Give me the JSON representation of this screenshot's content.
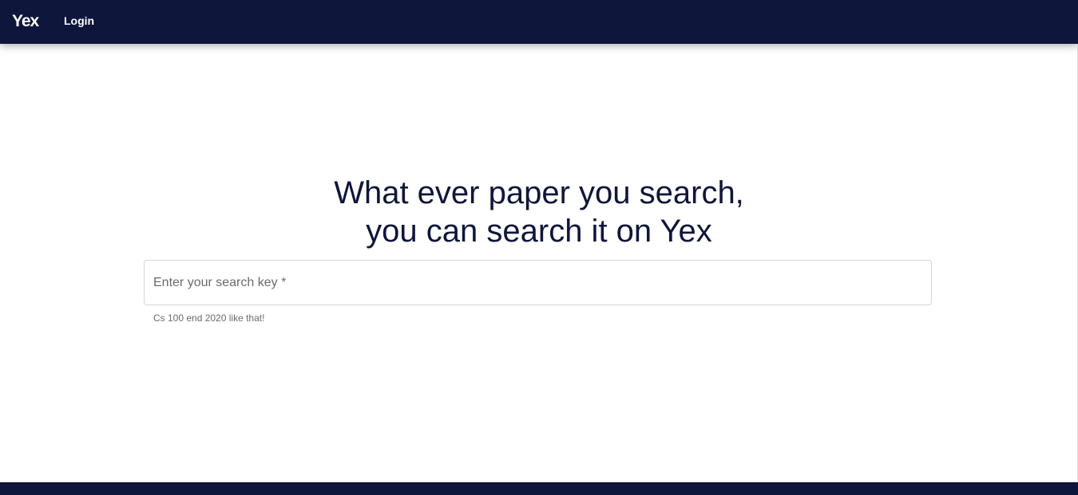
{
  "header": {
    "brand": "Yex",
    "login_label": "Login"
  },
  "hero": {
    "line1": "What ever paper you search,",
    "line2": "you can search it on Yex"
  },
  "search": {
    "placeholder": "Enter your search key *",
    "value": "",
    "helper_text": "Cs 100 end 2020 like that!"
  },
  "colors": {
    "navbar": "#0e163c",
    "heading": "#0e163c",
    "footer": "#0e163c"
  }
}
